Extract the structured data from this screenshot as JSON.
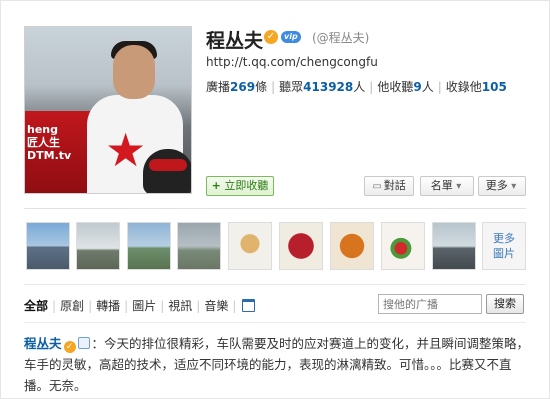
{
  "profile": {
    "name": "程丛夫",
    "handle": "(@程丛夫)",
    "url": "http://t.qq.com/chengcongfu",
    "vip_label": "vip",
    "avatar_text": "heng\n匠人生\nDTM.tv"
  },
  "stats": [
    {
      "label": "廣播",
      "value": "269",
      "unit": "條"
    },
    {
      "label": "聽眾",
      "value": "413928",
      "unit": "人"
    },
    {
      "label": "他收聽",
      "value": "9",
      "unit": "人"
    },
    {
      "label": "收錄他",
      "value": "105",
      "unit": ""
    }
  ],
  "actions": {
    "follow": "立即收聽",
    "chat": "對話",
    "card": "名單",
    "more": "更多"
  },
  "photos": {
    "more_label_line1": "更多",
    "more_label_line2": "圖片"
  },
  "tabs": [
    {
      "label": "全部",
      "active": true
    },
    {
      "label": "原創",
      "active": false
    },
    {
      "label": "轉播",
      "active": false
    },
    {
      "label": "圖片",
      "active": false
    },
    {
      "label": "視訊",
      "active": false
    },
    {
      "label": "音樂",
      "active": false
    }
  ],
  "search": {
    "placeholder": "搜他的广播",
    "button": "搜索"
  },
  "post": {
    "author": "程丛夫",
    "separator": "：",
    "text": "今天的排位很精彩，车队需要及时的应对赛道上的变化，并且瞬间调整策略，车手的灵敏，高超的技术，适应不同环境的能力，表现的淋漓精致。可惜。。。比赛又不直播。无奈。"
  },
  "colors": {
    "link": "#0b5fa5",
    "follow_green": "#2f7d16",
    "verify_orange": "#f5a623"
  }
}
